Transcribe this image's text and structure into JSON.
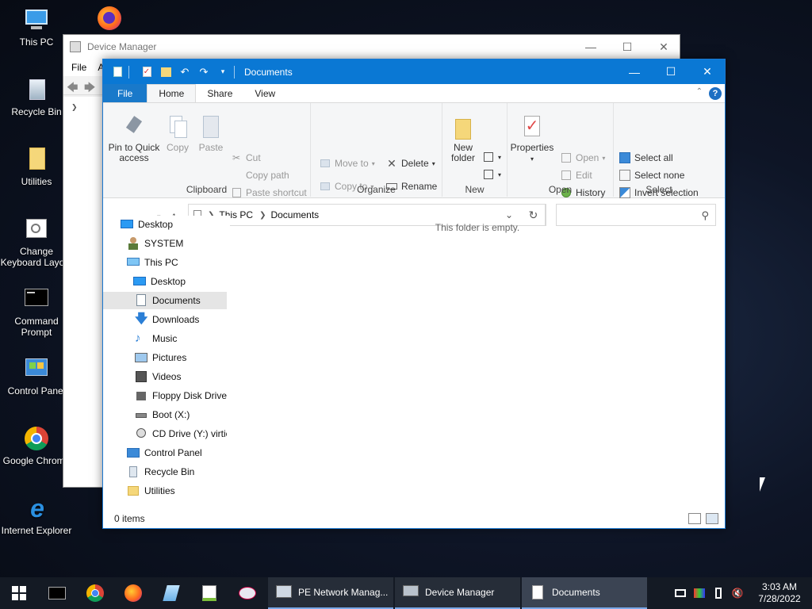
{
  "desktop": {
    "icons": [
      {
        "label": "This PC"
      },
      {
        "label": "Recycle Bin"
      },
      {
        "label": "Utilities"
      },
      {
        "label": "Change Keyboard Layout"
      },
      {
        "label": "Command Prompt"
      },
      {
        "label": "Control Panel"
      },
      {
        "label": "Google Chrome"
      },
      {
        "label": "Internet Explorer"
      }
    ]
  },
  "devmgr": {
    "title": "Device Manager",
    "menu": [
      "File",
      "A"
    ]
  },
  "explorer": {
    "title": "Documents",
    "tabs": {
      "file": "File",
      "home": "Home",
      "share": "Share",
      "view": "View"
    },
    "ribbon": {
      "clipboard": {
        "label": "Clipboard",
        "pin": "Pin to Quick access",
        "copy": "Copy",
        "paste": "Paste",
        "cut": "Cut",
        "copy_path": "Copy path",
        "paste_shortcut": "Paste shortcut"
      },
      "organize": {
        "label": "Organize",
        "move_to": "Move to",
        "copy_to": "Copy to",
        "delete": "Delete",
        "rename": "Rename"
      },
      "new": {
        "label": "New",
        "new_folder": "New folder"
      },
      "open": {
        "label": "Open",
        "properties": "Properties",
        "open": "Open",
        "edit": "Edit",
        "history": "History"
      },
      "select": {
        "label": "Select",
        "select_all": "Select all",
        "select_none": "Select none",
        "invert": "Invert selection"
      }
    },
    "address": {
      "crumbs": [
        "This PC",
        "Documents"
      ]
    },
    "nav": [
      {
        "label": "Desktop"
      },
      {
        "label": "SYSTEM"
      },
      {
        "label": "This PC"
      },
      {
        "label": "Desktop"
      },
      {
        "label": "Documents"
      },
      {
        "label": "Downloads"
      },
      {
        "label": "Music"
      },
      {
        "label": "Pictures"
      },
      {
        "label": "Videos"
      },
      {
        "label": "Floppy Disk Drive"
      },
      {
        "label": "Boot (X:)"
      },
      {
        "label": "CD Drive (Y:) virtic"
      },
      {
        "label": "Control Panel"
      },
      {
        "label": "Recycle Bin"
      },
      {
        "label": "Utilities"
      }
    ],
    "empty_message": "This folder is empty.",
    "status": "0 items"
  },
  "taskbar": {
    "tasks": [
      {
        "label": "PE Network Manag..."
      },
      {
        "label": "Device Manager"
      },
      {
        "label": "Documents"
      }
    ],
    "clock": {
      "time": "3:03 AM",
      "date": "7/28/2022"
    }
  }
}
